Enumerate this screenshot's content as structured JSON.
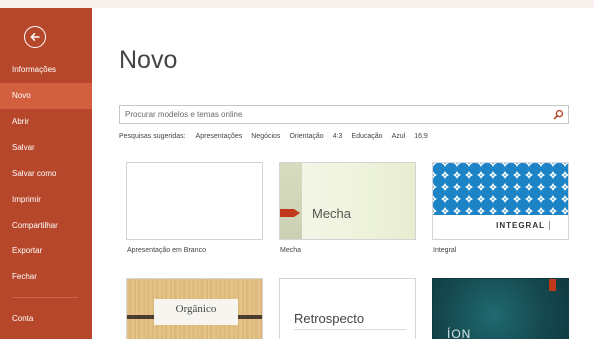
{
  "sidebar": {
    "back_icon": "back-arrow-icon",
    "items": [
      {
        "label": "Informações"
      },
      {
        "label": "Novo",
        "active": true
      },
      {
        "label": "Abrir"
      },
      {
        "label": "Salvar"
      },
      {
        "label": "Salvar como"
      },
      {
        "label": "Imprimir"
      },
      {
        "label": "Compartilhar"
      },
      {
        "label": "Exportar"
      },
      {
        "label": "Fechar"
      },
      {
        "label": "Conta"
      }
    ],
    "colors": {
      "background": "#b7472a",
      "active": "#d25f3d"
    }
  },
  "main": {
    "title": "Novo",
    "search": {
      "placeholder": "Procurar modelos e temas online",
      "value": "",
      "icon": "search-icon"
    },
    "suggestions": {
      "label": "Pesquisas sugeridas:",
      "items": [
        "Apresentações",
        "Negócios",
        "Orientação",
        "4:3",
        "Educação",
        "Azul",
        "16:9"
      ]
    },
    "templates": [
      {
        "caption": "Apresentação em Branco",
        "thumb_text": ""
      },
      {
        "caption": "Mecha",
        "thumb_text": "Mecha"
      },
      {
        "caption": "Integral",
        "thumb_text": "INTEGRAL"
      },
      {
        "caption": "",
        "thumb_text": "Orgânico"
      },
      {
        "caption": "",
        "thumb_text": "Retrospecto"
      },
      {
        "caption": "",
        "thumb_text": "ÍON"
      }
    ]
  }
}
